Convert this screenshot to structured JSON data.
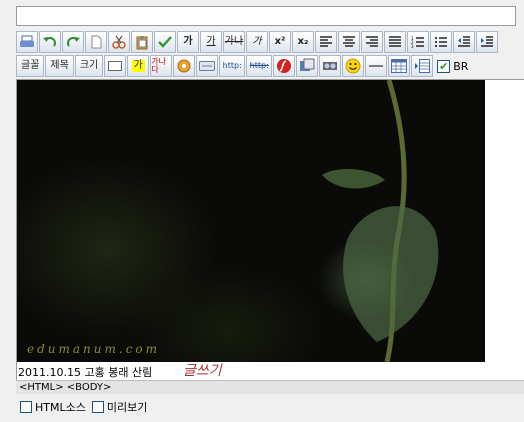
{
  "title_input": {
    "value": "",
    "placeholder": ""
  },
  "toolbar_row2": {
    "font_label": "글꼴",
    "heading_label": "제목",
    "size_label": "크기",
    "bg_label": "가",
    "char_label": "가나다",
    "url_label": "http:",
    "unlink_label": "http:",
    "br_label": "BR",
    "br_checked": true
  },
  "toolbar_row1_text": {
    "bold_like": "가",
    "underline_like": "가",
    "strike_like": "가나",
    "italic_like": "가",
    "sup": "x²",
    "sub": "x₂"
  },
  "editor": {
    "photo_watermark": "edumanum.com",
    "caption": "2011.10.15 고홍 봉래 산림",
    "handwritten": "글쓰기"
  },
  "pathbar": {
    "text": "<HTML> <BODY>"
  },
  "bottom_options": {
    "html_source": "HTML소스",
    "preview": "미리보기"
  },
  "colors": {
    "accent_red": "#a33434",
    "leaf_green": "#5a7850"
  }
}
